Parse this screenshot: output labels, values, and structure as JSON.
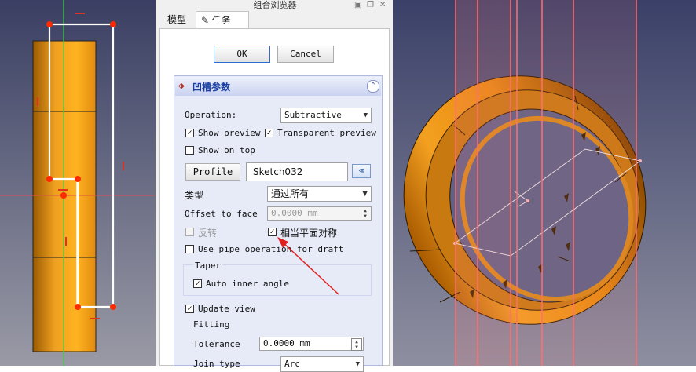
{
  "panel": {
    "title": "组合浏览器",
    "tabs": [
      {
        "label": "模型"
      },
      {
        "label": "任务"
      }
    ],
    "ok_label": "OK",
    "cancel_label": "Cancel",
    "group_title": "凹槽参数",
    "operation_label": "Operation:",
    "operation_value": "Subtractive",
    "show_preview_label": "Show preview",
    "transparent_preview_label": "Transparent preview",
    "show_on_top_label": "Show on top",
    "profile_label": "Profile",
    "profile_value": "Sketch032",
    "type_label": "类型",
    "type_value": "通过所有",
    "offset_label": "Offset to face",
    "offset_value": "0.0000 mm",
    "reversed_label": "反转",
    "symmetric_label": "相当平面对称",
    "pipe_label": "Use pipe operation for draft",
    "taper_label": "Taper",
    "auto_inner_label": "Auto inner angle",
    "update_view_label": "Update view",
    "fitting_label": "Fitting",
    "tolerance_label": "Tolerance",
    "tolerance_value": "0.0000 mm",
    "join_type_label": "Join type",
    "join_type_value": "Arc"
  },
  "colors": {
    "accent": "#1a3fa0",
    "sketch": "#ffffff",
    "sketch_point": "#ff2a00",
    "ring_orange": "#f39a10",
    "arrow_red": "#e02020"
  }
}
